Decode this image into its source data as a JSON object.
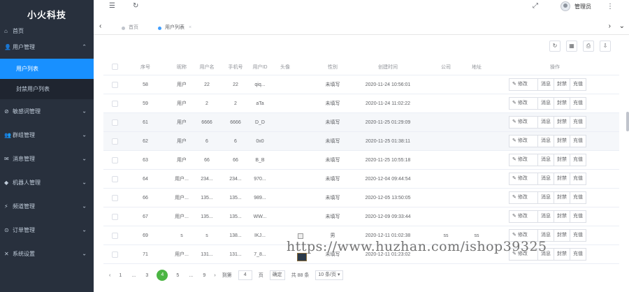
{
  "app": {
    "logo": "小火科技"
  },
  "sidebar": {
    "items": [
      {
        "label": "首页",
        "icon": "home-icon"
      },
      {
        "label": "用户管理",
        "icon": "user-icon",
        "expanded": true,
        "children": [
          {
            "label": "用户列表",
            "active": true
          },
          {
            "label": "封禁用户列表"
          }
        ]
      },
      {
        "label": "敏感词管理",
        "icon": "shield-icon"
      },
      {
        "label": "群组管理",
        "icon": "group-icon"
      },
      {
        "label": "消息管理",
        "icon": "message-icon"
      },
      {
        "label": "机器人管理",
        "icon": "robot-icon"
      },
      {
        "label": "频道管理",
        "icon": "channel-icon"
      },
      {
        "label": "订单管理",
        "icon": "order-icon"
      },
      {
        "label": "系统设置",
        "icon": "settings-icon"
      }
    ]
  },
  "header": {
    "user_name": "管理员"
  },
  "tabs": [
    {
      "label": "首页",
      "active": false
    },
    {
      "label": "用户列表",
      "active": true
    }
  ],
  "table": {
    "columns": [
      "序号",
      "昵称",
      "用户名",
      "手机号",
      "用户ID",
      "头像",
      "性别",
      "创建时间",
      "公司",
      "地址",
      "操作"
    ],
    "ops": {
      "edit": "修改",
      "info": "消息",
      "ban": "封禁",
      "recharge": "充值"
    },
    "rows": [
      {
        "id": "58",
        "nick": "用户",
        "uname": "22",
        "phone": "22",
        "uid": "qiq...",
        "gender": "未填写",
        "created": "2020-11-24 10:56:01",
        "company": "",
        "address": ""
      },
      {
        "id": "59",
        "nick": "用户",
        "uname": "2",
        "phone": "2",
        "uid": "aTa",
        "gender": "未填写",
        "created": "2020-11-24 11:02:22",
        "company": "",
        "address": ""
      },
      {
        "id": "61",
        "nick": "用户",
        "uname": "6666",
        "phone": "6666",
        "uid": "D_D",
        "gender": "未填写",
        "created": "2020-11-25 01:29:09",
        "company": "",
        "address": ""
      },
      {
        "id": "62",
        "nick": "用户",
        "uname": "6",
        "phone": "6",
        "uid": "0x0",
        "gender": "未填写",
        "created": "2020-11-25 01:38:11",
        "company": "",
        "address": ""
      },
      {
        "id": "63",
        "nick": "用户",
        "uname": "66",
        "phone": "66",
        "uid": "B_B",
        "gender": "未填写",
        "created": "2020-11-25 10:55:18",
        "company": "",
        "address": ""
      },
      {
        "id": "64",
        "nick": "用户...",
        "uname": "234...",
        "phone": "234...",
        "uid": "970...",
        "gender": "未填写",
        "created": "2020-12-04 09:44:54",
        "company": "",
        "address": ""
      },
      {
        "id": "66",
        "nick": "用户...",
        "uname": "135...",
        "phone": "135...",
        "uid": "989...",
        "gender": "未填写",
        "created": "2020-12-05 13:50:05",
        "company": "",
        "address": ""
      },
      {
        "id": "67",
        "nick": "用户...",
        "uname": "135...",
        "phone": "135...",
        "uid": "WW...",
        "gender": "未填写",
        "created": "2020-12-09 09:33:44",
        "company": "",
        "address": ""
      },
      {
        "id": "69",
        "nick": "s",
        "uname": "s",
        "phone": "138...",
        "uid": "IKJ...",
        "gender": "男",
        "created": "2020-12-11 01:02:38",
        "company": "ss",
        "address": "ss"
      },
      {
        "id": "71",
        "nick": "用户...",
        "uname": "131...",
        "phone": "131...",
        "uid": "7_8...",
        "gender": "未填写",
        "created": "2020-12-11 01:23:02",
        "company": "",
        "address": ""
      }
    ]
  },
  "pagination": {
    "pages": [
      "1",
      "...",
      "3",
      "4",
      "5",
      "...",
      "9"
    ],
    "current": "4",
    "goto_label": "到第",
    "goto_value": "4",
    "page_suffix": "页",
    "confirm": "确定",
    "total": "共 88 条",
    "page_size": "10 条/页"
  },
  "watermark": "https://www.huzhan.com/ishop39325"
}
